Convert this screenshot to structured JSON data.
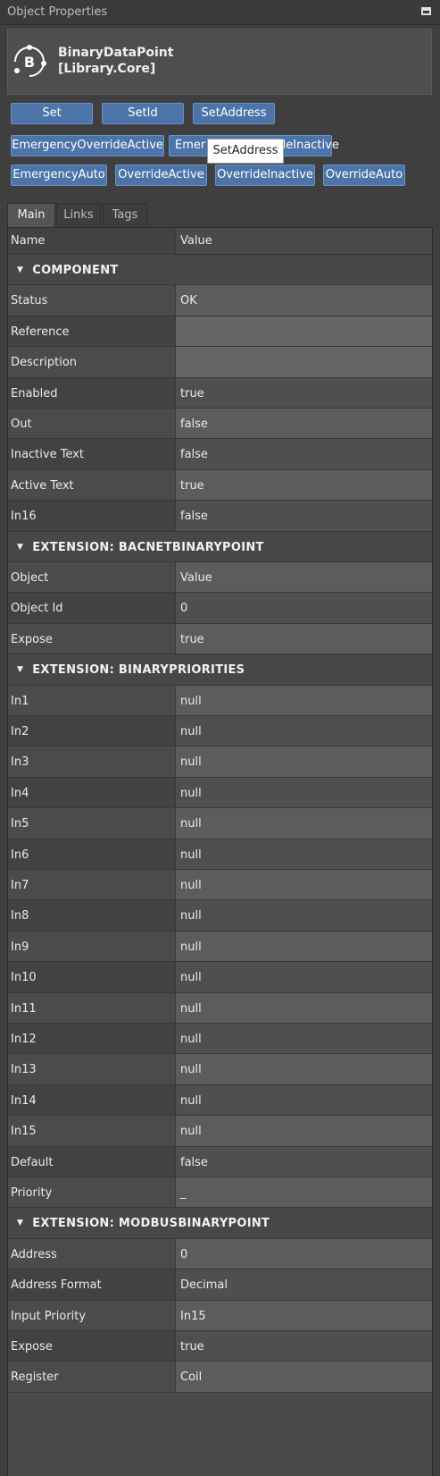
{
  "panel": {
    "title": "Object Properties",
    "component_name": "BinaryDataPoint",
    "library": "[Library.Core]",
    "logo_letter": "B"
  },
  "buttons": [
    {
      "label": "Set"
    },
    {
      "label": "SetId"
    },
    {
      "label": "SetAddress"
    },
    {
      "label": "EmergencyOverrideActive"
    },
    {
      "label": "EmergencyOverrideInactive"
    },
    {
      "label": "EmergencyAuto"
    },
    {
      "label": "OverrideActive"
    },
    {
      "label": "OverrideInactive"
    },
    {
      "label": "OverrideAuto"
    }
  ],
  "button_partial": {
    "left": "Emer",
    "right": "deInactive"
  },
  "tooltip": "SetAddress",
  "tabs": [
    {
      "label": "Main"
    },
    {
      "label": "Links"
    },
    {
      "label": "Tags"
    }
  ],
  "grid": {
    "header": {
      "name": "Name",
      "value": "Value"
    },
    "rows": [
      {
        "type": "section",
        "title": "COMPONENT"
      },
      {
        "name": "Status",
        "value": "OK"
      },
      {
        "name": "Reference",
        "value": ""
      },
      {
        "name": "Description",
        "value": ""
      },
      {
        "name": "Enabled",
        "value": "true"
      },
      {
        "name": "Out",
        "value": "false"
      },
      {
        "name": "Inactive Text",
        "value": "false"
      },
      {
        "name": "Active Text",
        "value": "true"
      },
      {
        "name": "In16",
        "value": "false"
      },
      {
        "type": "section",
        "title": "EXTENSION: BACNETBINARYPOINT"
      },
      {
        "name": "Object",
        "value": "Value"
      },
      {
        "name": "Object Id",
        "value": "0"
      },
      {
        "name": "Expose",
        "value": "true"
      },
      {
        "type": "section",
        "title": "EXTENSION: BINARYPRIORITIES"
      },
      {
        "name": "In1",
        "value": "null"
      },
      {
        "name": "In2",
        "value": "null"
      },
      {
        "name": "In3",
        "value": "null"
      },
      {
        "name": "In4",
        "value": "null"
      },
      {
        "name": "In5",
        "value": "null"
      },
      {
        "name": "In6",
        "value": "null"
      },
      {
        "name": "In7",
        "value": "null"
      },
      {
        "name": "In8",
        "value": "null"
      },
      {
        "name": "In9",
        "value": "null"
      },
      {
        "name": "In10",
        "value": "null"
      },
      {
        "name": "In11",
        "value": "null"
      },
      {
        "name": "In12",
        "value": "null"
      },
      {
        "name": "In13",
        "value": "null"
      },
      {
        "name": "In14",
        "value": "null"
      },
      {
        "name": "In15",
        "value": "null"
      },
      {
        "name": "Default",
        "value": "false"
      },
      {
        "name": "Priority",
        "value": "_"
      },
      {
        "type": "section",
        "title": "EXTENSION: MODBUSBINARYPOINT"
      },
      {
        "name": "Address",
        "value": "0"
      },
      {
        "name": "Address Format",
        "value": "Decimal"
      },
      {
        "name": "Input Priority",
        "value": "In15"
      },
      {
        "name": "Expose",
        "value": "true"
      },
      {
        "name": "Register",
        "value": "Coil"
      }
    ]
  }
}
